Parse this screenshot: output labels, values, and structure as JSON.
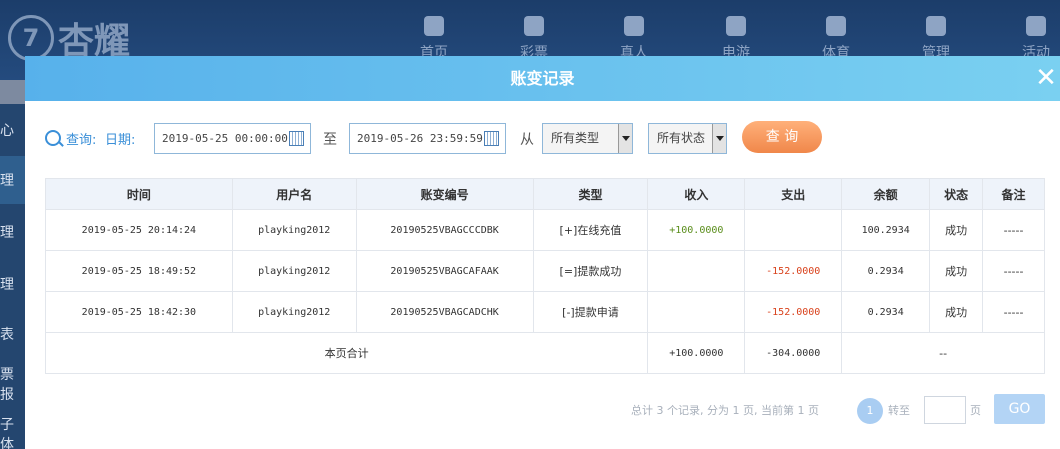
{
  "background": {
    "logo_text": "杏耀",
    "nav": [
      "首页",
      "彩票",
      "真人",
      "电游",
      "体育",
      "管理",
      "活动"
    ],
    "sidebar": [
      "心",
      "理",
      "理",
      "理",
      "表",
      "票报",
      "子体"
    ]
  },
  "modal": {
    "title": "账变记录",
    "close": "✕",
    "query_label": "查询:",
    "date_label": "日期:",
    "date_from": "2019-05-25 00:00:00",
    "to_label": "至",
    "date_to": "2019-05-26 23:59:59",
    "from_label": "从",
    "type_select": "所有类型",
    "status_select": "所有状态",
    "search_button": "查 询"
  },
  "table": {
    "headers": [
      "时间",
      "用户名",
      "账变编号",
      "类型",
      "收入",
      "支出",
      "余额",
      "状态",
      "备注"
    ],
    "rows": [
      [
        "2019-05-25 20:14:24",
        "playking2012",
        "20190525VBAGCCCDBK",
        "[+]在线充值",
        "+100.0000",
        "",
        "100.2934",
        "成功",
        "-----"
      ],
      [
        "2019-05-25 18:49:52",
        "playking2012",
        "20190525VBAGCAFAAK",
        "[=]提款成功",
        "",
        "-152.0000",
        "0.2934",
        "成功",
        "-----"
      ],
      [
        "2019-05-25 18:42:30",
        "playking2012",
        "20190525VBAGCADCHK",
        "[-]提款申请",
        "",
        "-152.0000",
        "0.2934",
        "成功",
        "-----"
      ]
    ],
    "summary": {
      "label": "本页合计",
      "income": "+100.0000",
      "expense": "-304.0000",
      "rest": "--"
    }
  },
  "pagination": {
    "total_prefix": "总计",
    "total": "3",
    "records_label": "个记录,",
    "pages_prefix": "分为",
    "pages": "1",
    "pages_suffix": "页,",
    "current_prefix": "当前第",
    "current": "1",
    "current_suffix": "页",
    "page_button": "1",
    "jump_label": "转至",
    "jump_value": "",
    "page_unit": "页",
    "go_button": "GO"
  }
}
